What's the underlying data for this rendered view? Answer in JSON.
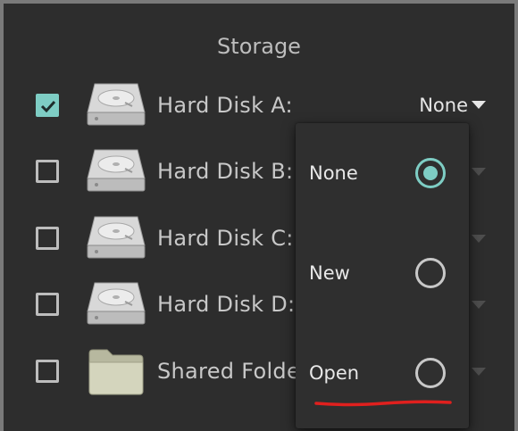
{
  "section_title": "Storage",
  "rows": [
    {
      "label": "Hard Disk A:",
      "checked": true,
      "value": "None",
      "icon": "hard-disk-icon"
    },
    {
      "label": "Hard Disk B:",
      "checked": false,
      "icon": "hard-disk-icon"
    },
    {
      "label": "Hard Disk C:",
      "checked": false,
      "icon": "hard-disk-icon"
    },
    {
      "label": "Hard Disk D:",
      "checked": false,
      "icon": "hard-disk-icon"
    },
    {
      "label": "Shared Folde",
      "checked": false,
      "icon": "folder-icon"
    }
  ],
  "menu": {
    "items": [
      {
        "label": "None",
        "selected": true
      },
      {
        "label": "New",
        "selected": false
      },
      {
        "label": "Open",
        "selected": false
      }
    ]
  },
  "colors": {
    "accent": "#7ecdc4",
    "panel": "#2d2d2d",
    "annotation": "#e0201e"
  }
}
